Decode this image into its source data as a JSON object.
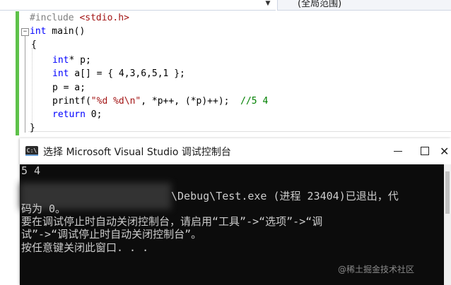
{
  "editor": {
    "scope_selector": "(全局范围)",
    "lines": {
      "l1": {
        "pp": "#include ",
        "str": "<stdio.h>"
      },
      "l2": {
        "kw": "int",
        "rest": " main()"
      },
      "l3": {
        "text": "{"
      },
      "l4": {
        "kw": "int",
        "rest": "* p;"
      },
      "l5": {
        "kw": "int",
        "rest": " a[] = { 4,3,6,5,1 };"
      },
      "l6": {
        "text": "p = a;"
      },
      "l7": {
        "fn": "printf(",
        "str": "\"%d %d\\n\"",
        "rest": ", *p++, (*p)++);  ",
        "cmt": "//5 4"
      },
      "l8": {
        "kw": "return",
        "rest": " 0;"
      },
      "l9": {
        "text": "}"
      }
    }
  },
  "console": {
    "title": "选择 Microsoft Visual Studio 调试控制台",
    "output": {
      "line1": "5 4",
      "line2": "\\Debug\\Test.exe (进程 23404)已退出，代",
      "line3": "码为 0。",
      "line4": "要在调试停止时自动关闭控制台，请启用“工具”->“选项”->“调",
      "line5": "试”->“调试停止时自动关闭控制台”。",
      "line6": "按任意键关闭此窗口. . ."
    }
  },
  "watermark": "@稀土掘金技术社区",
  "colors": {
    "keyword": "#0000ff",
    "string": "#a31515",
    "comment": "#008000",
    "preprocessor": "#808080",
    "change_bar": "#5ec24a",
    "console_bg": "#0c0c0c",
    "console_text": "#cccccc"
  }
}
